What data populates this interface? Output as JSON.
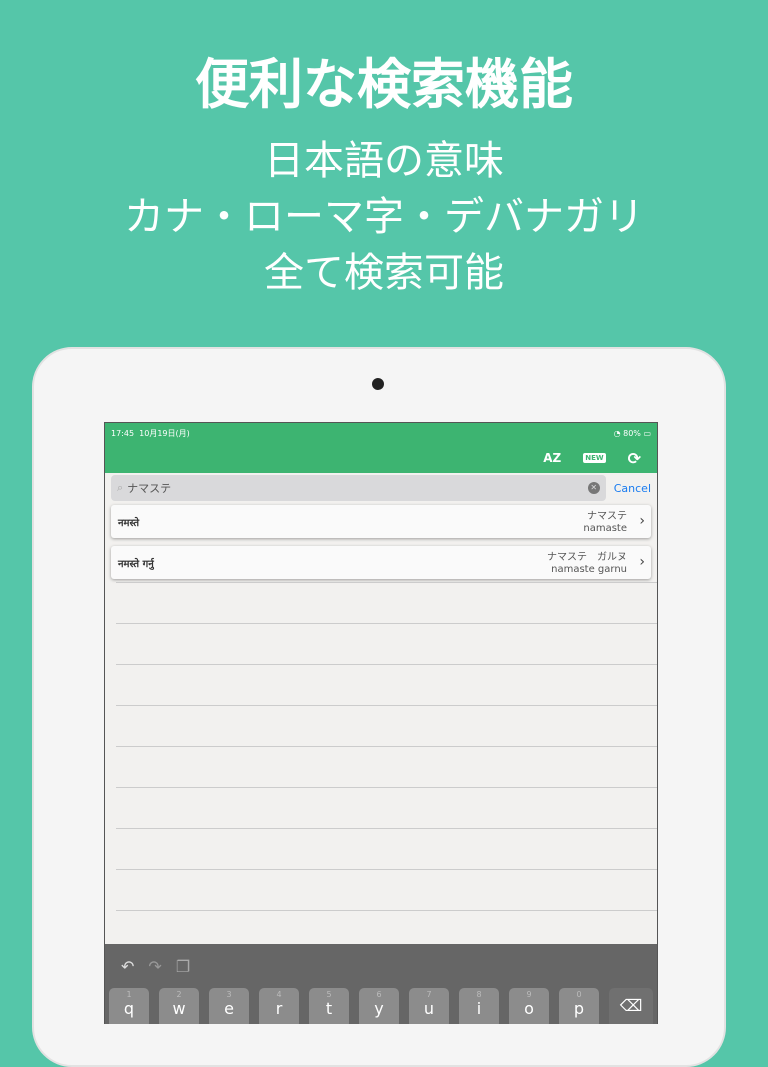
{
  "headline": "便利な検索機能",
  "sublines": [
    "日本語の意味",
    "カナ・ローマ字・デバナガリ",
    "全て検索可能"
  ],
  "status": {
    "time": "17:45",
    "date": "10月19日(月)",
    "battery": "80%"
  },
  "nav": {
    "sort_icon": "AZ",
    "new_icon": "NEW"
  },
  "search": {
    "value": "ナマステ",
    "cancel": "Cancel"
  },
  "results": [
    {
      "devanagari": "नमस्ते",
      "kana": "ナマステ",
      "romaji": "namaste"
    },
    {
      "devanagari": "नमस्ते गर्नु",
      "kana": "ナマステ　ガルヌ",
      "romaji": "namaste garnu"
    }
  ],
  "keyboard": {
    "keys": [
      [
        "1",
        "q"
      ],
      [
        "2",
        "w"
      ],
      [
        "3",
        "e"
      ],
      [
        "4",
        "r"
      ],
      [
        "5",
        "t"
      ],
      [
        "6",
        "y"
      ],
      [
        "7",
        "u"
      ],
      [
        "8",
        "i"
      ],
      [
        "9",
        "o"
      ],
      [
        "0",
        "p"
      ]
    ]
  },
  "colors": {
    "background": "#55c6a9",
    "nav": "#3db471",
    "accent": "#1a7cf0"
  }
}
